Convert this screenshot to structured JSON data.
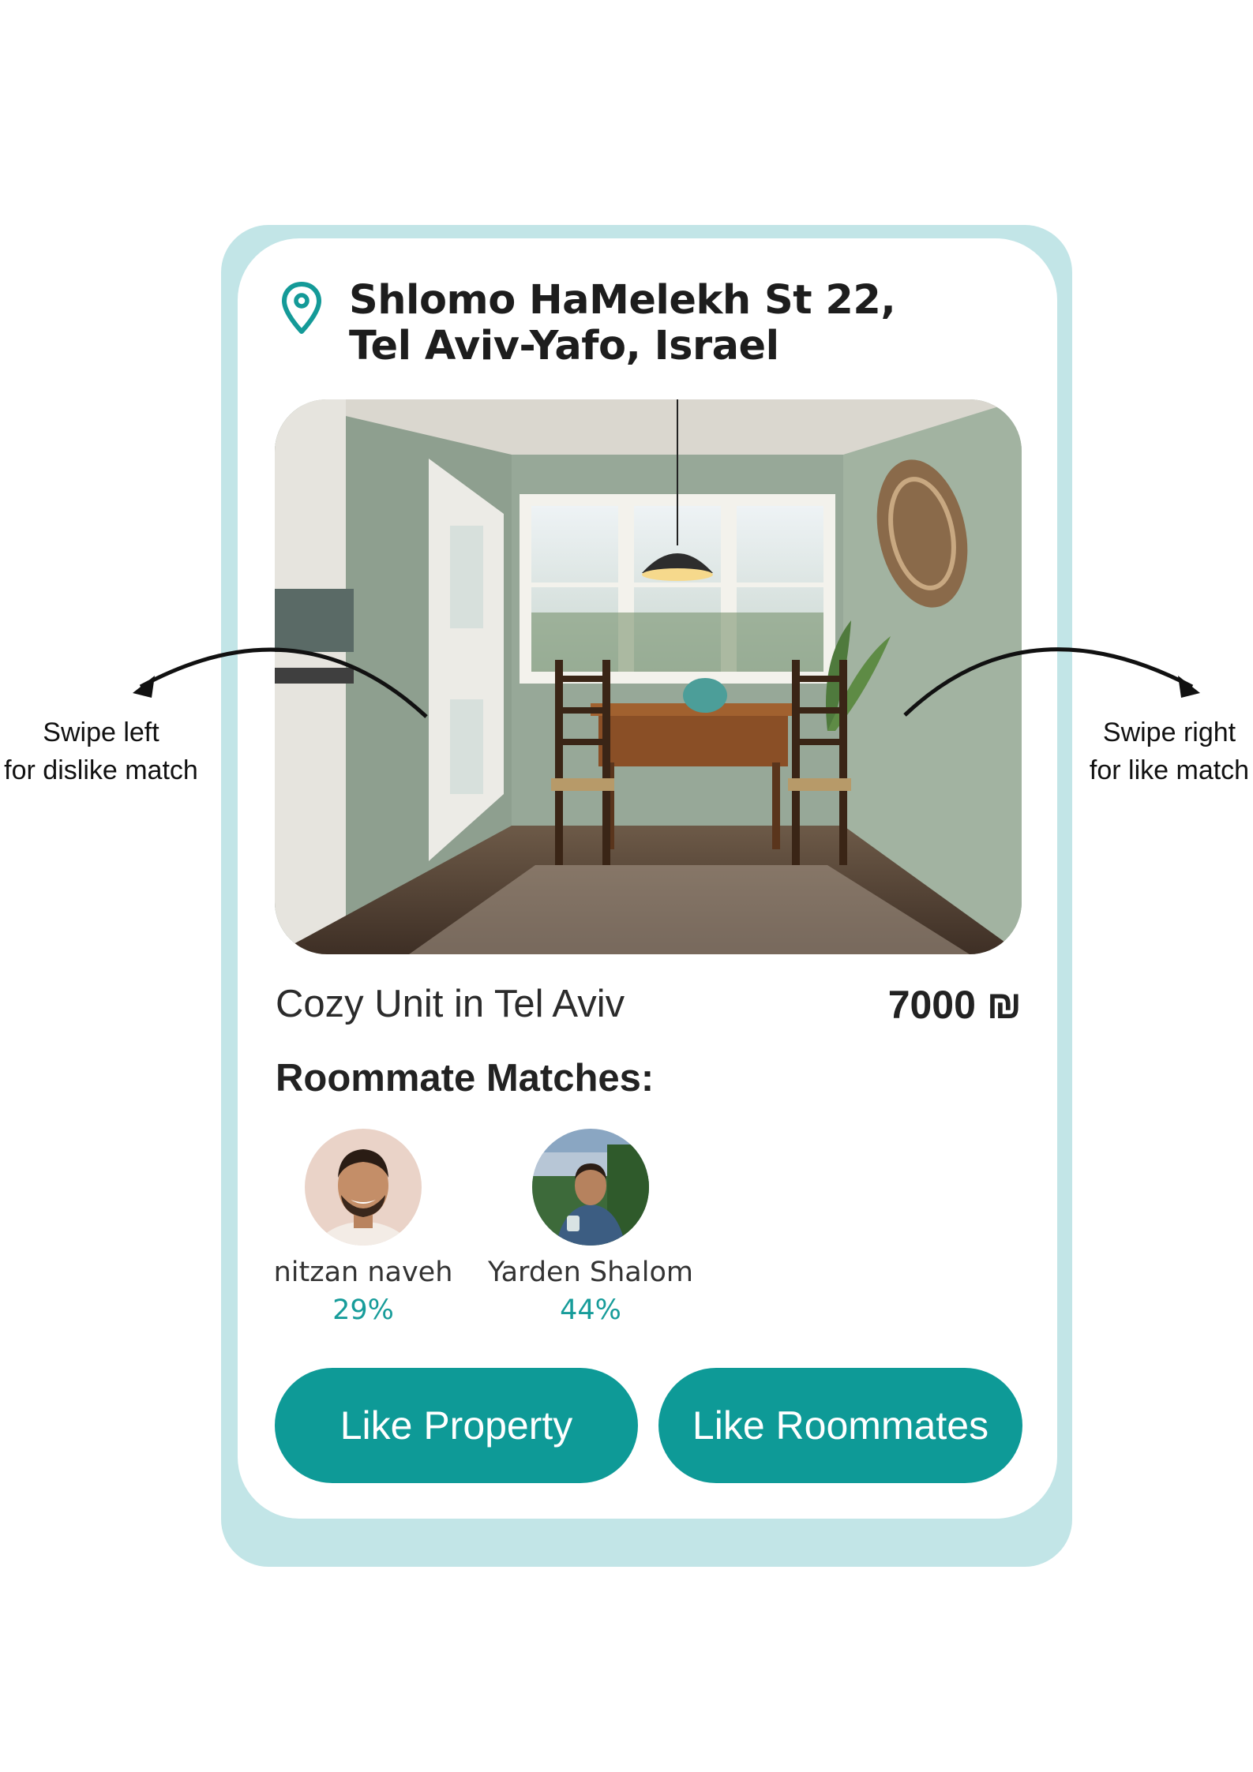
{
  "card": {
    "address": "Shlomo HaMelekh St 22, Tel Aviv-Yafo, Israel",
    "listing_title": "Cozy Unit in Tel Aviv",
    "price": "7000 ₪",
    "matches_heading": "Roommate Matches:"
  },
  "matches": [
    {
      "name": "nitzan naveh",
      "percent": "29%"
    },
    {
      "name": "Yarden Shalom",
      "percent": "44%"
    }
  ],
  "buttons": {
    "like_property": "Like Property",
    "like_roommates": "Like Roommates"
  },
  "hints": {
    "left_line1": "Swipe left",
    "left_line2": "for dislike match",
    "right_line1": "Swipe right",
    "right_line2": "for like match"
  },
  "colors": {
    "accent": "#0e9a97",
    "card_border": "#c2e5e7",
    "percent_text": "#179c9a"
  },
  "icons": {
    "location": "location-pin-icon",
    "arrow_left": "curved-arrow-left-icon",
    "arrow_right": "curved-arrow-right-icon"
  }
}
